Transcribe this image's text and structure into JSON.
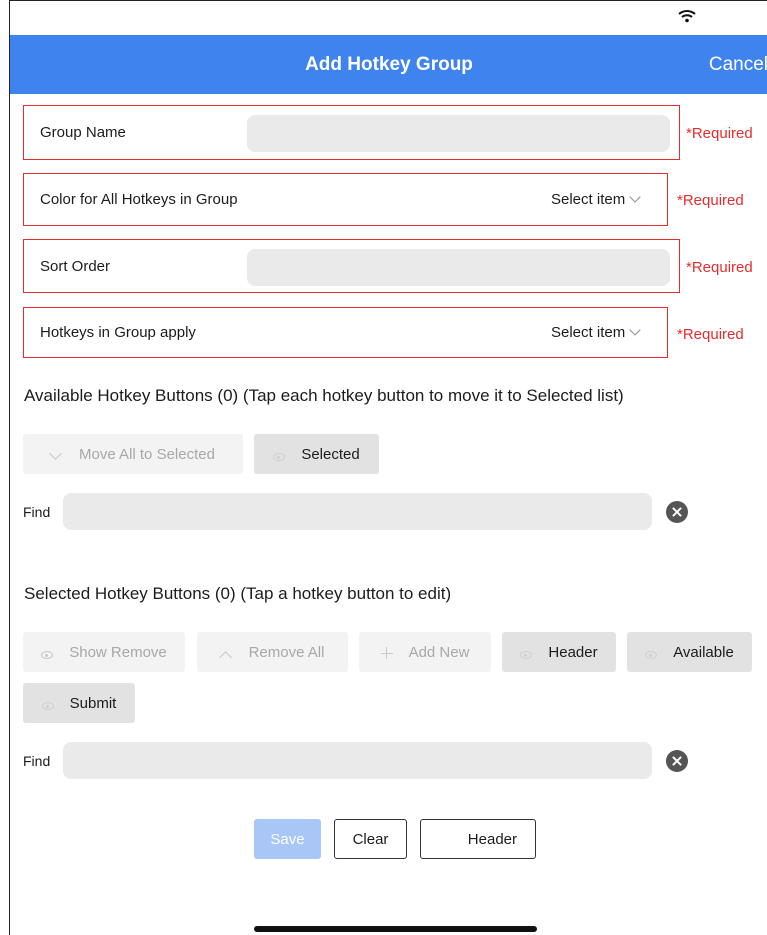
{
  "nav": {
    "title": "Add Hotkey Group",
    "cancel": "Cancel"
  },
  "fields": {
    "group_name": {
      "label": "Group Name",
      "required": "*Required"
    },
    "color": {
      "label": "Color for All Hotkeys in Group",
      "value": "Select item",
      "required": "*Required"
    },
    "sort_order": {
      "label": "Sort Order",
      "required": "*Required"
    },
    "apply": {
      "label": "Hotkeys in Group apply",
      "value": "Select item",
      "required": "*Required"
    }
  },
  "available": {
    "title": "Available Hotkey Buttons (0) (Tap each hotkey button to move it to Selected list)",
    "move_all": "Move All to Selected",
    "selected": "Selected",
    "find_label": "Find"
  },
  "selected_section": {
    "title": "Selected Hotkey Buttons (0) (Tap a hotkey button to edit)",
    "show_remove": "Show Remove",
    "remove_all": "Remove All",
    "add_new": "Add New",
    "header": "Header",
    "available": "Available",
    "submit": "Submit",
    "find_label": "Find"
  },
  "footer": {
    "save": "Save",
    "clear": "Clear",
    "header": "Header"
  },
  "colors": {
    "nav_bg": "#3f83ee",
    "required": "#e52d2d",
    "save_disabled": "#a8c6f6"
  }
}
